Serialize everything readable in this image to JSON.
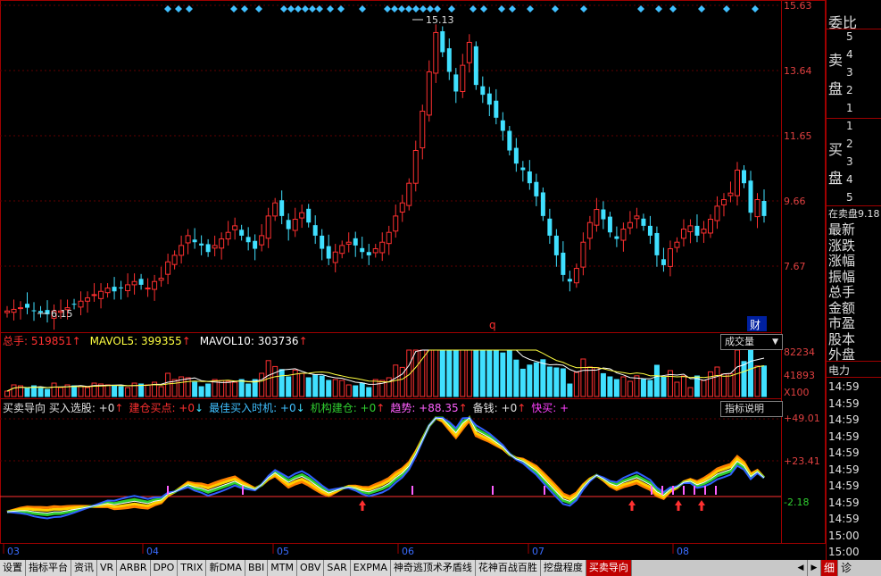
{
  "price_axis": {
    "ticks": [
      "15.63",
      "13.64",
      "11.65",
      "9.66",
      "7.67"
    ]
  },
  "price_annotations": {
    "high": "15.13",
    "low": "6.15",
    "corner_q": "q",
    "corner_cai": "财"
  },
  "volume_panel": {
    "total_label": "总手: ",
    "total_value": "519851",
    "ma5_label": "MAVOL5: ",
    "ma5_value": "399355",
    "ma10_label": "MAVOL10: ",
    "ma10_value": "303736",
    "dropdown": "成交量",
    "ticks": [
      "82234",
      "41893",
      "X100"
    ]
  },
  "indicator_panel": {
    "name": "买卖导向",
    "items": [
      {
        "label": "买入选股:",
        "value": "+0",
        "arrow": "↑",
        "color": "#e0e0e0"
      },
      {
        "label": "建仓买点:",
        "value": "+0",
        "arrow": "↓",
        "color": "#ff3030"
      },
      {
        "label": "最佳买入时机:",
        "value": "+0",
        "arrow": "↓",
        "color": "#40c0ff"
      },
      {
        "label": "机构建仓:",
        "value": "+0",
        "arrow": "↑",
        "color": "#30d030"
      },
      {
        "label": "趋势:",
        "value": "+88.35",
        "arrow": "↑",
        "color": "#ff60ff"
      },
      {
        "label": "备钱:",
        "value": "+0",
        "arrow": "↑",
        "color": "#e0e0e0"
      },
      {
        "label": "快买:",
        "value": "+",
        "arrow": "",
        "color": "#ff40ff"
      }
    ],
    "dropdown": "指标说明",
    "ticks": [
      "+49.01",
      "+23.41",
      "-2.18"
    ]
  },
  "x_axis": {
    "labels": [
      "03",
      "04",
      "05",
      "06",
      "07",
      "08"
    ]
  },
  "right_panel": {
    "title": "委比",
    "sell_label": [
      "卖",
      "盘"
    ],
    "buy_label": [
      "买",
      "盘"
    ],
    "sell_levels": [
      "5",
      "4",
      "3",
      "2",
      "1"
    ],
    "buy_levels": [
      "1",
      "2",
      "3",
      "4",
      "5"
    ],
    "price_line": "在卖盘9.18",
    "fields": [
      "最新",
      "涨跌",
      "涨幅",
      "振幅",
      "总手",
      "金额",
      "市盈",
      "股本",
      "外盘"
    ],
    "power_label": "电力",
    "times": [
      "14:59",
      "14:59",
      "14:59",
      "14:59",
      "14:59",
      "14:59",
      "14:59",
      "14:59",
      "14:59",
      "15:00",
      "15:00"
    ]
  },
  "bottom_tabs": [
    "设置",
    "指标平台",
    "资讯",
    "VR",
    "ARBR",
    "DPO",
    "TRIX",
    "新DMA",
    "BBI",
    "MTM",
    "OBV",
    "SAR",
    "EXPMA",
    "神奇逃顶术矛盾线",
    "花神百战百胜",
    "挖盘程度",
    "买卖导向"
  ],
  "active_tab": "买卖导向",
  "bottom_right": [
    "细",
    "诊"
  ],
  "colors": {
    "up": "#ff3030",
    "down": "#40e0ff",
    "grid": "#a00000",
    "axis_text": "#e04040"
  },
  "chart_data": {
    "type": "candlestick",
    "x_labels": [
      "03",
      "04",
      "05",
      "06",
      "07",
      "08"
    ],
    "price_ticks": [
      15.63,
      13.64,
      11.65,
      9.66,
      7.67
    ],
    "high_label": 15.13,
    "low_label": 6.15,
    "closes": [
      6.3,
      6.35,
      6.4,
      6.4,
      6.3,
      6.25,
      6.2,
      6.3,
      6.3,
      6.4,
      6.5,
      6.6,
      6.7,
      6.8,
      6.9,
      7.0,
      6.9,
      7.0,
      7.1,
      7.2,
      7.1,
      7.0,
      7.2,
      7.3,
      7.8,
      8.0,
      8.3,
      8.6,
      8.4,
      8.3,
      8.1,
      8.3,
      8.5,
      8.7,
      8.9,
      8.6,
      8.4,
      8.2,
      8.6,
      9.2,
      9.6,
      9.2,
      8.8,
      9.1,
      9.3,
      9.0,
      8.6,
      8.2,
      7.9,
      8.1,
      8.3,
      8.4,
      8.3,
      8.1,
      8.0,
      8.2,
      8.4,
      8.7,
      9.2,
      9.6,
      10.2,
      11.2,
      12.4,
      13.6,
      14.8,
      14.2,
      13.6,
      13.0,
      13.8,
      14.5,
      13.2,
      12.9,
      12.6,
      12.2,
      11.8,
      11.2,
      10.8,
      10.6,
      10.2,
      9.8,
      9.2,
      8.6,
      8.0,
      7.4,
      7.2,
      7.6,
      8.4,
      9.0,
      9.4,
      9.1,
      8.7,
      8.5,
      8.8,
      9.0,
      9.2,
      8.9,
      8.6,
      8.0,
      7.7,
      8.2,
      8.4,
      8.8,
      8.9,
      8.6,
      8.8,
      9.1,
      9.5,
      9.7,
      9.9,
      10.6,
      10.2,
      9.3,
      9.7,
      9.2
    ],
    "volume_ticks": [
      82234,
      41893
    ],
    "indicator_ticks": [
      49.01,
      23.41,
      -2.18
    ]
  }
}
